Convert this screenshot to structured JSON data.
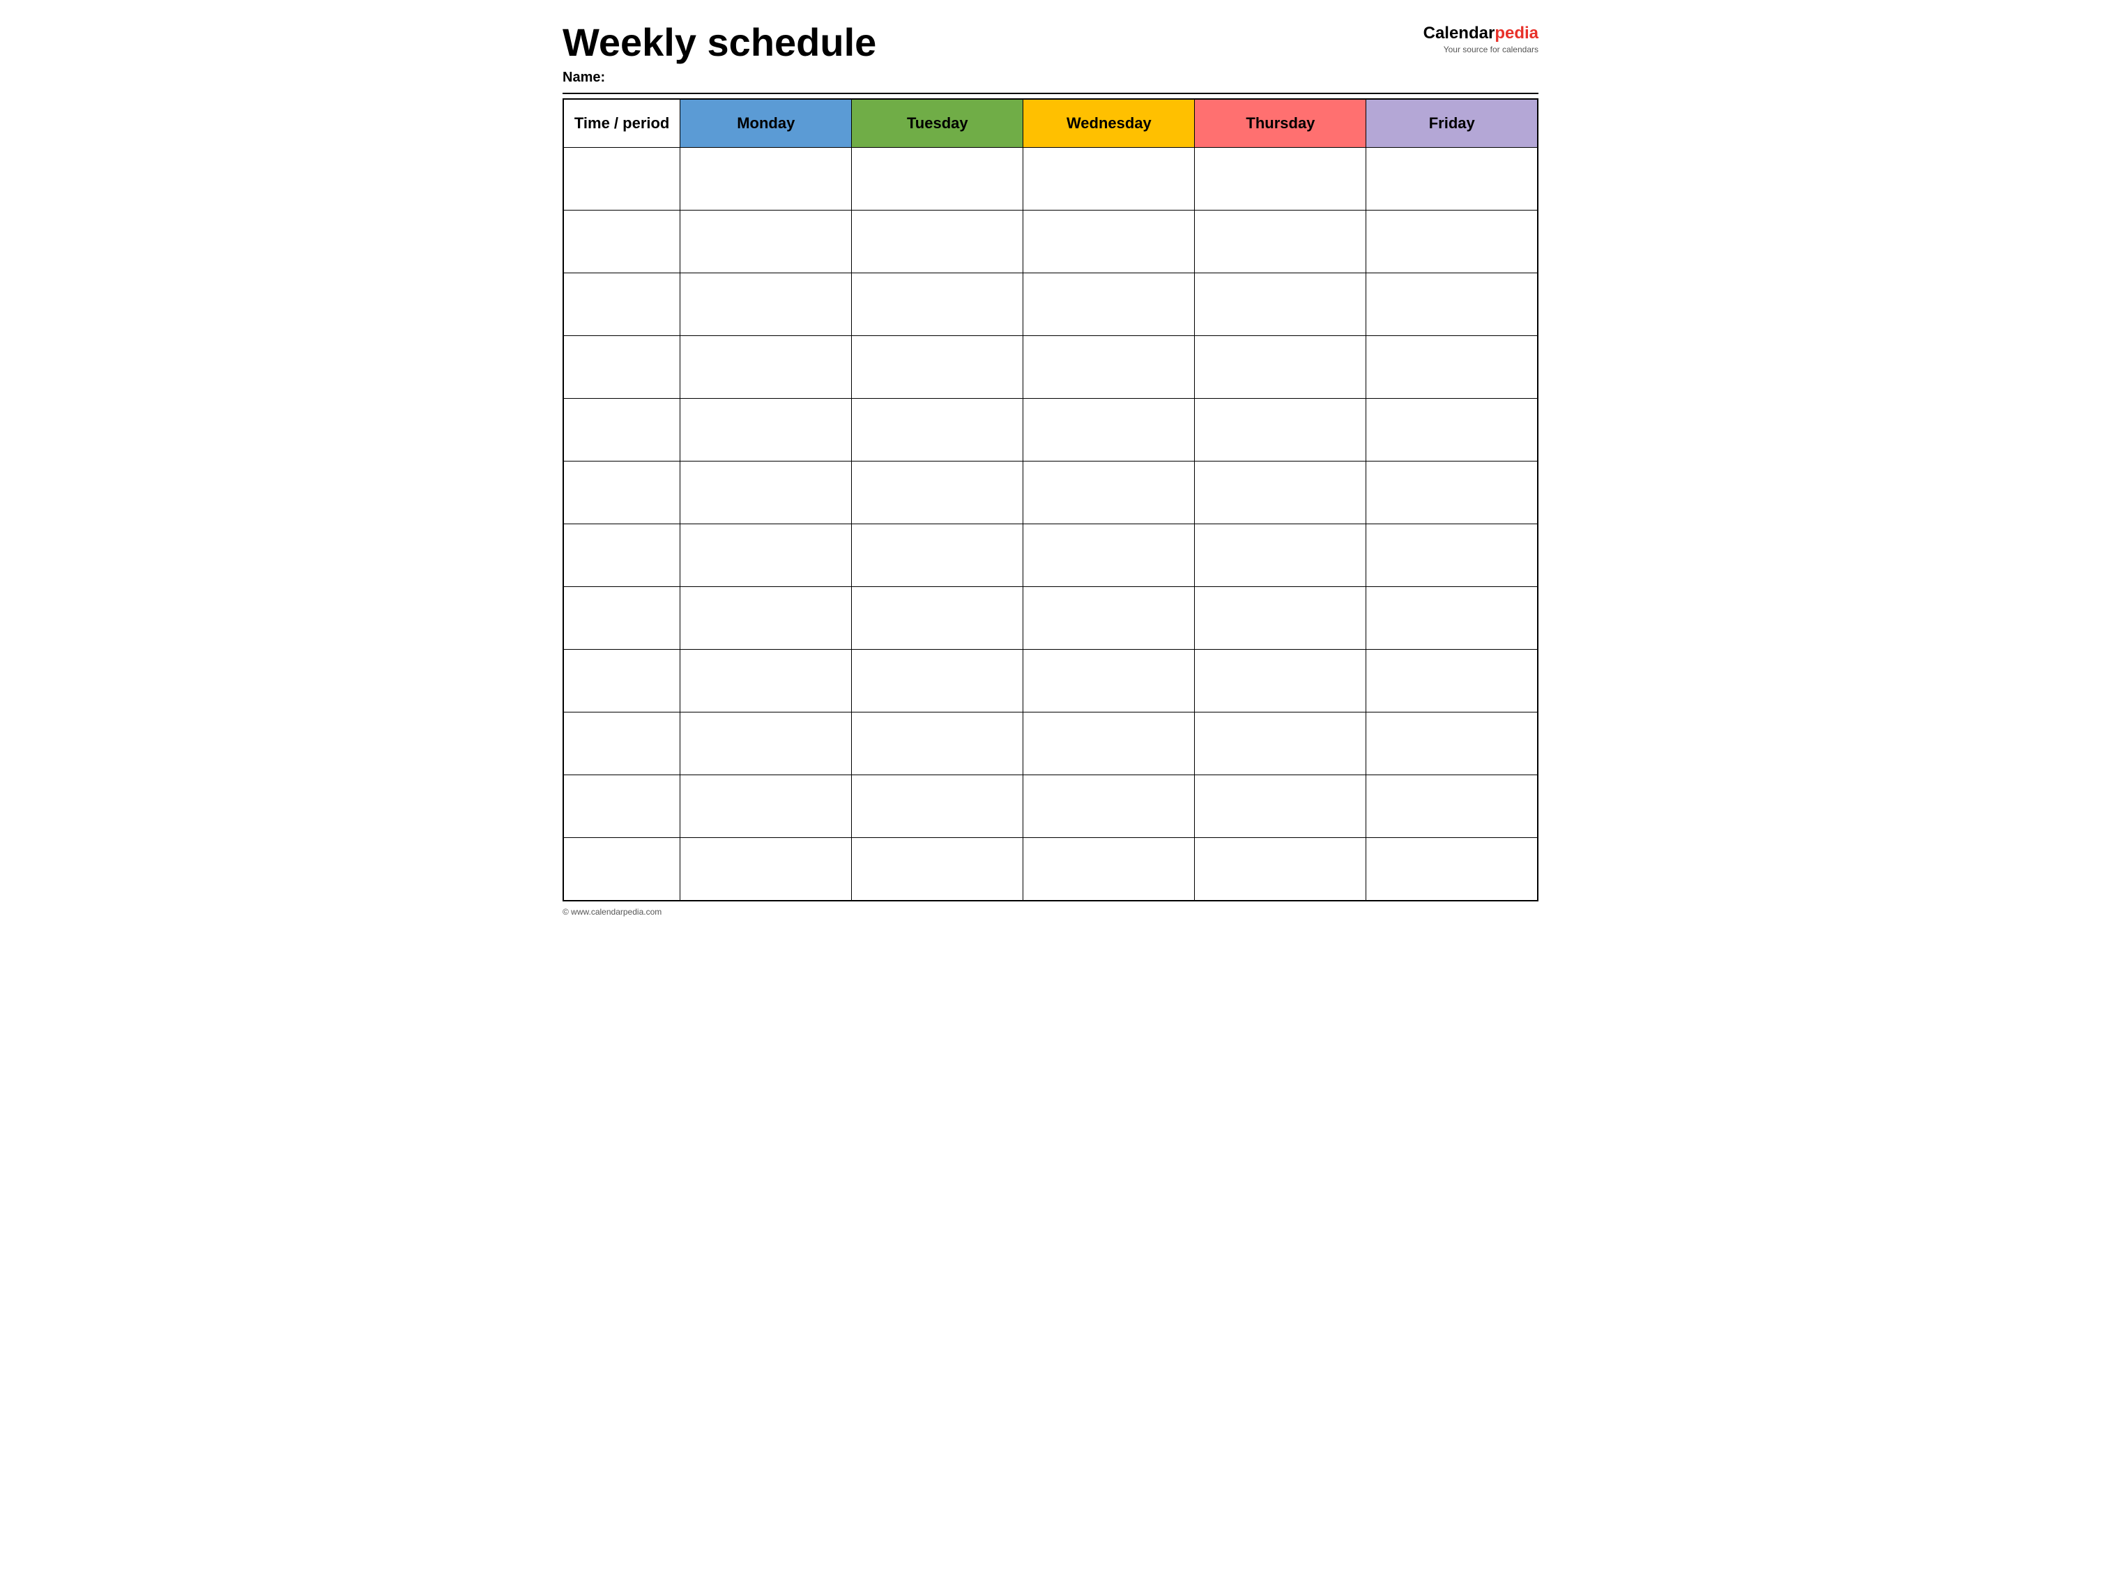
{
  "header": {
    "title": "Weekly schedule",
    "name_label": "Name:",
    "logo_calendar": "Calendar",
    "logo_pedia": "pedia",
    "logo_tagline": "Your source for calendars"
  },
  "table": {
    "columns": [
      {
        "id": "time",
        "label": "Time / period",
        "color": "#ffffff",
        "class": "th-time"
      },
      {
        "id": "monday",
        "label": "Monday",
        "color": "#5b9bd5",
        "class": "th-monday"
      },
      {
        "id": "tuesday",
        "label": "Tuesday",
        "color": "#70ad47",
        "class": "th-tuesday"
      },
      {
        "id": "wednesday",
        "label": "Wednesday",
        "color": "#ffc000",
        "class": "th-wednesday"
      },
      {
        "id": "thursday",
        "label": "Thursday",
        "color": "#ff7070",
        "class": "th-thursday"
      },
      {
        "id": "friday",
        "label": "Friday",
        "color": "#b4a7d6",
        "class": "th-friday"
      }
    ],
    "row_count": 12
  },
  "footer": {
    "url": "© www.calendarpedia.com"
  }
}
